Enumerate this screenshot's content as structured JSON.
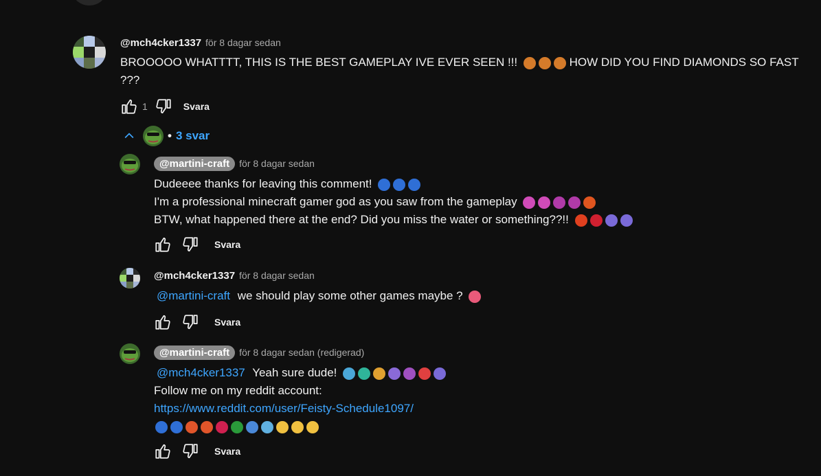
{
  "comment_main": {
    "author": "@mch4cker1337",
    "time": "för 8 dagar sedan",
    "text_line1": "BROOOOO WHATTTT, THIS IS THE BEST GAMEPLAY IVE EVER SEEN !!!",
    "text_line1_end": "HOW DID YOU FIND DIAMONDS SO FAST",
    "text_line2": "???",
    "likes": "1",
    "reply_label": "Svara"
  },
  "replies_toggle": {
    "label": "3 svar",
    "separator": "•"
  },
  "reply1": {
    "author": "@martini-craft",
    "time": "för 8 dagar sedan",
    "line1": "Dudeeee thanks for leaving this comment!",
    "line2": "I'm a professional minecraft gamer god as you saw from the gameplay",
    "line3": "BTW, what happened there at the end? Did you miss the water or something??!!",
    "reply_label": "Svara"
  },
  "reply2": {
    "author": "@mch4cker1337",
    "time": "för 8 dagar sedan",
    "mention": "@martini-craft",
    "text": "we should play some other games maybe ?",
    "reply_label": "Svara"
  },
  "reply3": {
    "author": "@martini-craft",
    "time": "för 8 dagar sedan (redigerad)",
    "mention": "@mch4cker1337",
    "line1": "Yeah sure dude!",
    "line2": "Follow me on my reddit account:",
    "link": "https://www.reddit.com/user/Feisty-Schedule1097/",
    "reply_label": "Svara"
  },
  "icons": {
    "like": "thumbs-up-icon",
    "dislike": "thumbs-down-icon",
    "collapse": "chevron-up-icon"
  },
  "colors": {
    "background": "#0f0f0f",
    "text": "#f1f1f1",
    "muted": "#aaaaaa",
    "link": "#3ea6ff",
    "chip": "#8a8a8a"
  }
}
